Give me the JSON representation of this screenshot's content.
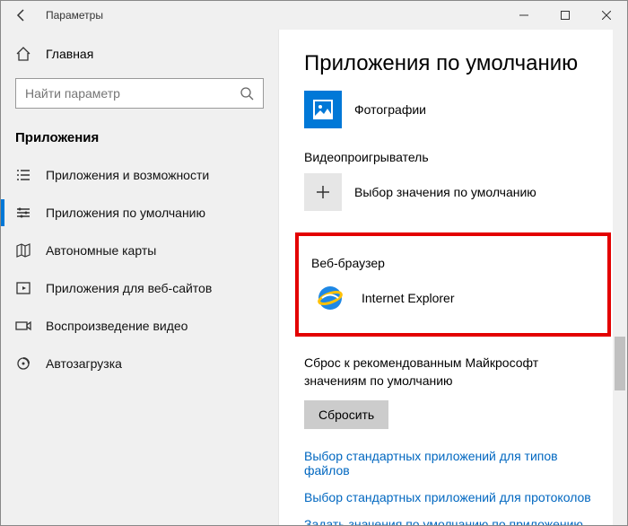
{
  "window": {
    "title": "Параметры"
  },
  "sidebar": {
    "home": "Главная",
    "search_placeholder": "Найти параметр",
    "section": "Приложения",
    "items": [
      {
        "label": "Приложения и возможности"
      },
      {
        "label": "Приложения по умолчанию"
      },
      {
        "label": "Автономные карты"
      },
      {
        "label": "Приложения для веб-сайтов"
      },
      {
        "label": "Воспроизведение видео"
      },
      {
        "label": "Автозагрузка"
      }
    ]
  },
  "main": {
    "heading": "Приложения по умолчанию",
    "photos": {
      "label": "Фотографии"
    },
    "video_player": {
      "category": "Видеопроигрыватель",
      "choose": "Выбор значения по умолчанию"
    },
    "web_browser": {
      "category": "Веб-браузер",
      "app": "Internet Explorer"
    },
    "reset": {
      "text": "Сброс к рекомендованным Майкрософт значениям по умолчанию",
      "button": "Сбросить"
    },
    "links": {
      "by_filetype": "Выбор стандартных приложений для типов файлов",
      "by_protocol": "Выбор стандартных приложений для протоколов",
      "by_app": "Задать значения по умолчанию по приложению"
    }
  }
}
